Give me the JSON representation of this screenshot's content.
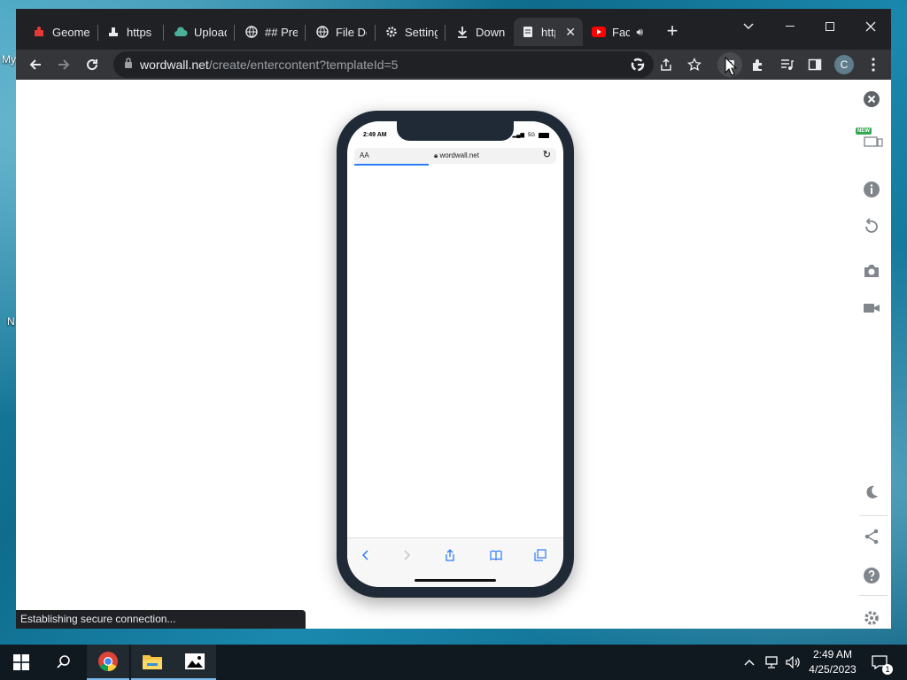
{
  "desktop": {
    "labels": [
      "My",
      "N"
    ]
  },
  "browser": {
    "tabs": [
      {
        "title": "Geome",
        "icon": "red-extension-icon"
      },
      {
        "title": "https://",
        "icon": "stamp-icon"
      },
      {
        "title": "Upload",
        "icon": "cloud-upload-icon"
      },
      {
        "title": "## Pres",
        "icon": "globe-icon"
      },
      {
        "title": "File Do",
        "icon": "globe-icon"
      },
      {
        "title": "Setting",
        "icon": "gear-icon"
      },
      {
        "title": "Downlo",
        "icon": "download-icon"
      },
      {
        "title": "http",
        "icon": "document-icon"
      },
      {
        "title": "Fac",
        "icon": "youtube-icon"
      }
    ],
    "url_domain": "wordwall.net",
    "url_path": "/create/entercontent?templateId=5",
    "profile_initial": "C",
    "status_text": "Establishing secure connection..."
  },
  "phone": {
    "time": "2:49 AM",
    "signal": "5G",
    "text_size_label": "AA",
    "domain": "wordwall.net",
    "load_progress": 0.37
  },
  "sidebar": {
    "badge": "NEW"
  },
  "taskbar": {
    "time": "2:49 AM",
    "date": "4/25/2023",
    "notification_count": "1"
  },
  "colors": {
    "accent": "#2d7cf6",
    "youtube": "#ff0000",
    "chrome_dark": "#202124",
    "new_badge": "#34a853"
  }
}
